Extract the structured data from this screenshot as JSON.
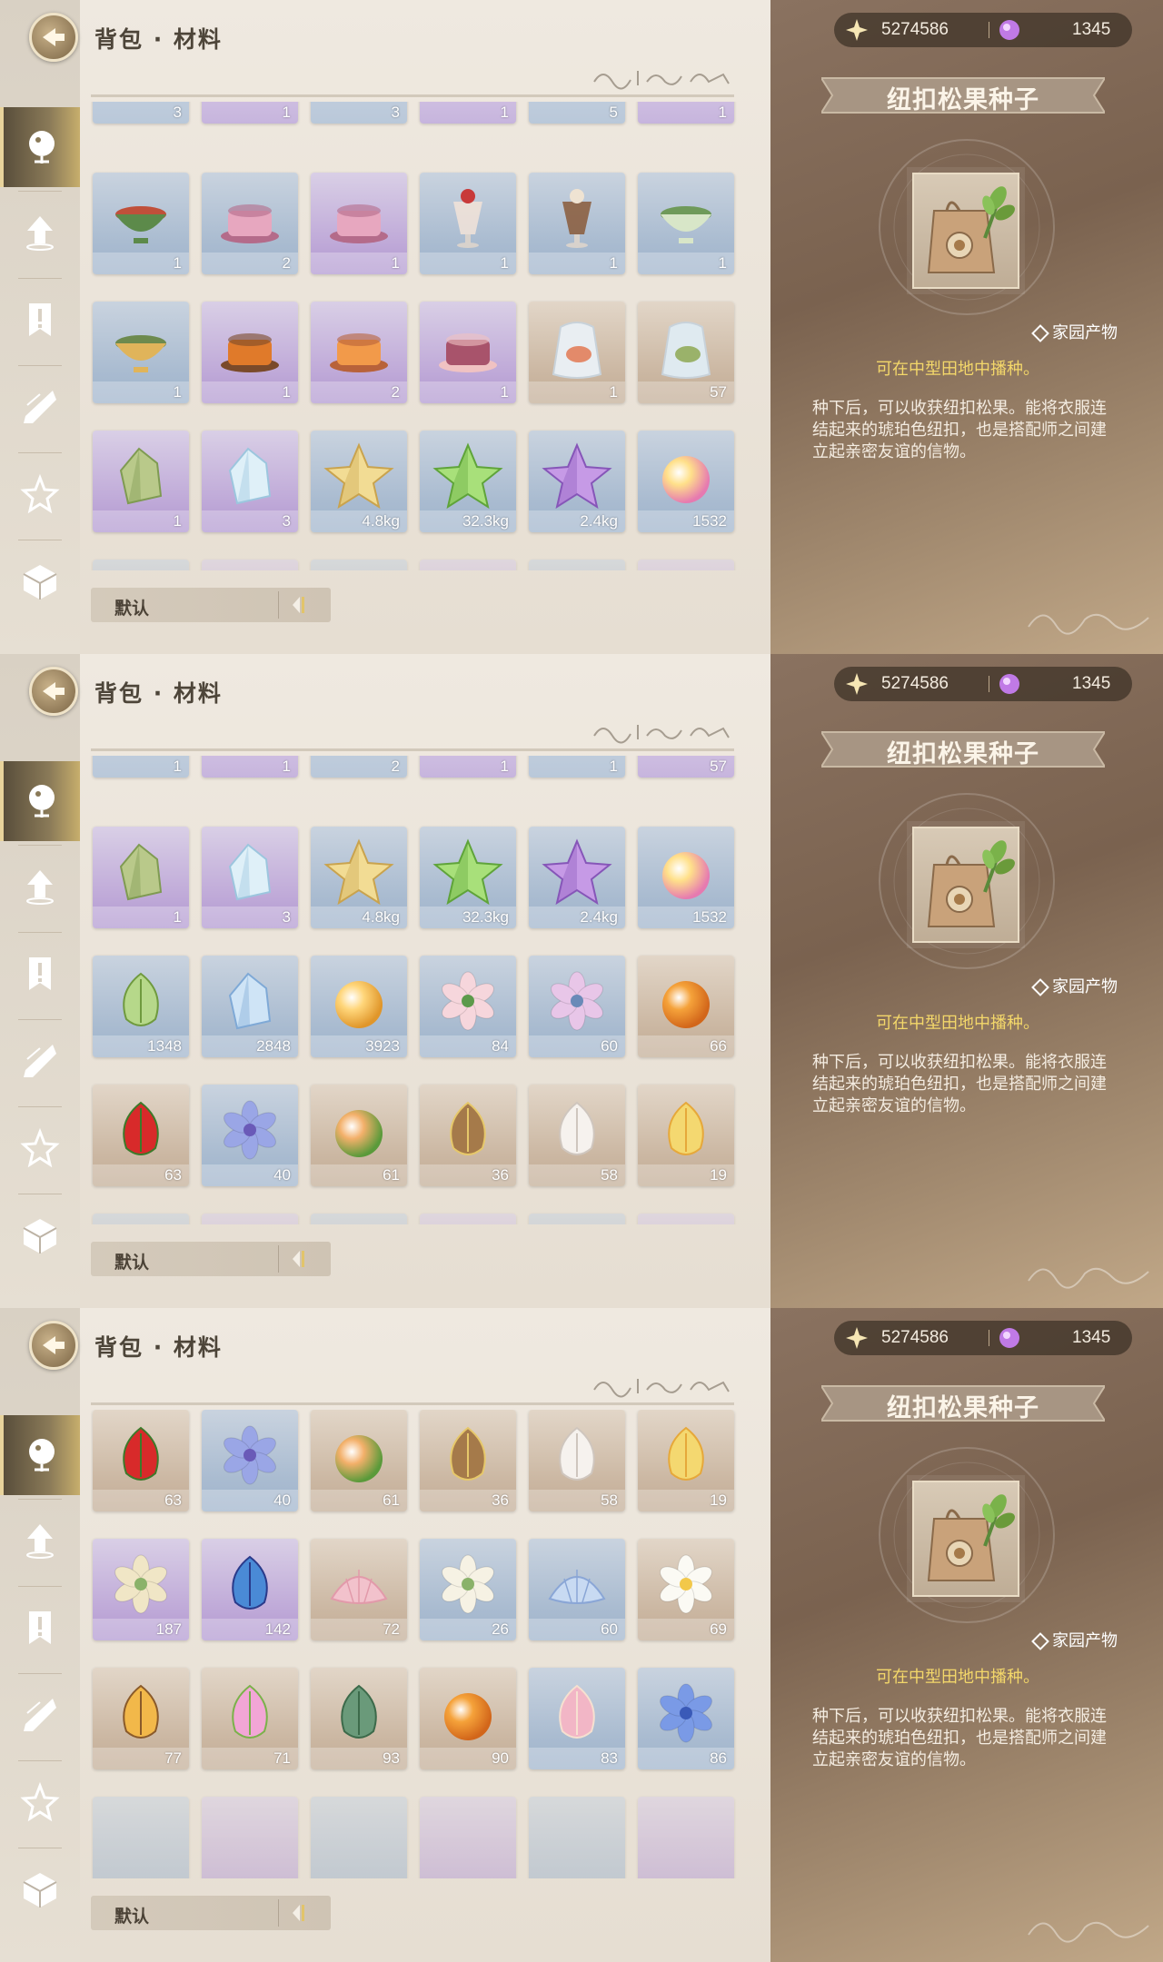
{
  "header": {
    "title": "背包 · 材料"
  },
  "sort": {
    "label": "默认"
  },
  "currency": {
    "gold": "5274586",
    "gems": "1345"
  },
  "detail": {
    "name": "纽扣松果种子",
    "category": "家园产物",
    "plant_hint": "可在中型田地中播种。",
    "description": "种下后，可以收获纽扣松果。能将衣服连结起来的琥珀色纽扣，也是搭配师之间建立起亲密友谊的信物。"
  },
  "sidebar": {
    "items": [
      {
        "name": "materials",
        "icon": "fish-badge-icon"
      },
      {
        "name": "upgrade",
        "icon": "upload-arrow-icon"
      },
      {
        "name": "notice",
        "icon": "banner-exclaim-icon"
      },
      {
        "name": "crystal",
        "icon": "crystal-shard-icon"
      },
      {
        "name": "star",
        "icon": "star-outline-icon"
      },
      {
        "name": "box",
        "icon": "box-icon"
      }
    ]
  },
  "screens": [
    {
      "partial_top": [
        "3",
        "1",
        "3",
        "1",
        "5",
        "1"
      ],
      "rows": [
        [
          {
            "icon": "noodle-bowl-icon",
            "bg": "blue",
            "qty": "1"
          },
          {
            "icon": "pink-buns-icon",
            "bg": "blue",
            "qty": "2"
          },
          {
            "icon": "pink-buns-icon",
            "bg": "purple",
            "qty": "1"
          },
          {
            "icon": "sundae-icon",
            "bg": "blue",
            "qty": "1"
          },
          {
            "icon": "milkshake-icon",
            "bg": "blue",
            "qty": "1"
          },
          {
            "icon": "tea-cup-icon",
            "bg": "blue",
            "qty": "1"
          }
        ],
        [
          {
            "icon": "green-bowl-icon",
            "bg": "blue",
            "qty": "1"
          },
          {
            "icon": "pumpkin-tray-icon",
            "bg": "purple",
            "qty": "1"
          },
          {
            "icon": "fox-cake-icon",
            "bg": "purple",
            "qty": "2"
          },
          {
            "icon": "layer-cake-icon",
            "bg": "purple",
            "qty": "1"
          },
          {
            "icon": "shrimp-bag-icon",
            "bg": "tan",
            "qty": "1"
          },
          {
            "icon": "fish-bag-icon",
            "bg": "tan",
            "qty": "57"
          }
        ],
        [
          {
            "icon": "green-crystal-icon",
            "bg": "purple",
            "qty": "1"
          },
          {
            "icon": "ice-crystal-icon",
            "bg": "purple",
            "qty": "3"
          },
          {
            "icon": "gold-star-icon",
            "bg": "blue",
            "qty": "4.8kg"
          },
          {
            "icon": "green-star-icon",
            "bg": "blue",
            "qty": "32.3kg"
          },
          {
            "icon": "purple-star-icon",
            "bg": "blue",
            "qty": "2.4kg"
          },
          {
            "icon": "rainbow-orb-icon",
            "bg": "blue",
            "qty": "1532"
          }
        ]
      ]
    },
    {
      "partial_top": [
        "1",
        "1",
        "2",
        "1",
        "1",
        "57"
      ],
      "rows": [
        [
          {
            "icon": "green-crystal-icon",
            "bg": "purple",
            "qty": "1"
          },
          {
            "icon": "ice-crystal-icon",
            "bg": "purple",
            "qty": "3"
          },
          {
            "icon": "gold-star-icon",
            "bg": "blue",
            "qty": "4.8kg"
          },
          {
            "icon": "green-star-icon",
            "bg": "blue",
            "qty": "32.3kg"
          },
          {
            "icon": "purple-star-icon",
            "bg": "blue",
            "qty": "2.4kg"
          },
          {
            "icon": "rainbow-orb-icon",
            "bg": "blue",
            "qty": "1532"
          }
        ],
        [
          {
            "icon": "leaf-icon",
            "bg": "blue",
            "qty": "1348"
          },
          {
            "icon": "blue-shard-icon",
            "bg": "blue",
            "qty": "2848"
          },
          {
            "icon": "gold-orb-icon",
            "bg": "blue",
            "qty": "3923"
          },
          {
            "icon": "pink-flower-icon",
            "bg": "blue",
            "qty": "84"
          },
          {
            "icon": "iris-flower-icon",
            "bg": "blue",
            "qty": "60"
          },
          {
            "icon": "orange-fruit-icon",
            "bg": "tan",
            "qty": "66"
          }
        ],
        [
          {
            "icon": "red-pepper-icon",
            "bg": "tan",
            "qty": "63"
          },
          {
            "icon": "blue-flower-icon",
            "bg": "blue",
            "qty": "40"
          },
          {
            "icon": "peach-icon",
            "bg": "tan",
            "qty": "61"
          },
          {
            "icon": "pinecone-icon",
            "bg": "tan",
            "qty": "36"
          },
          {
            "icon": "cotton-icon",
            "bg": "tan",
            "qty": "58"
          },
          {
            "icon": "golden-sprout-icon",
            "bg": "tan",
            "qty": "19"
          }
        ]
      ]
    },
    {
      "partial_top": [],
      "rows": [
        [
          {
            "icon": "red-pepper-icon",
            "bg": "tan",
            "qty": "63"
          },
          {
            "icon": "blue-flower-icon",
            "bg": "blue",
            "qty": "40"
          },
          {
            "icon": "peach-icon",
            "bg": "tan",
            "qty": "61"
          },
          {
            "icon": "pinecone-icon",
            "bg": "tan",
            "qty": "36"
          },
          {
            "icon": "cotton-icon",
            "bg": "tan",
            "qty": "58"
          },
          {
            "icon": "golden-sprout-icon",
            "bg": "tan",
            "qty": "19"
          }
        ],
        [
          {
            "icon": "lily-bulb-icon",
            "bg": "purple",
            "qty": "187"
          },
          {
            "icon": "blue-bulb-icon",
            "bg": "purple",
            "qty": "142"
          },
          {
            "icon": "pink-shell-icon",
            "bg": "tan",
            "qty": "72"
          },
          {
            "icon": "white-bouquet-icon",
            "bg": "blue",
            "qty": "26"
          },
          {
            "icon": "blue-shell-icon",
            "bg": "blue",
            "qty": "60"
          },
          {
            "icon": "daisy-icon",
            "bg": "tan",
            "qty": "69"
          }
        ],
        [
          {
            "icon": "amber-seed-icon",
            "bg": "tan",
            "qty": "77"
          },
          {
            "icon": "pink-puff-icon",
            "bg": "tan",
            "qty": "71"
          },
          {
            "icon": "green-pod-icon",
            "bg": "tan",
            "qty": "93"
          },
          {
            "icon": "orange-fruit-icon",
            "bg": "tan",
            "qty": "90"
          },
          {
            "icon": "coral-icon",
            "bg": "blue",
            "qty": "83"
          },
          {
            "icon": "blue-lily-icon",
            "bg": "blue",
            "qty": "86"
          }
        ]
      ]
    }
  ]
}
